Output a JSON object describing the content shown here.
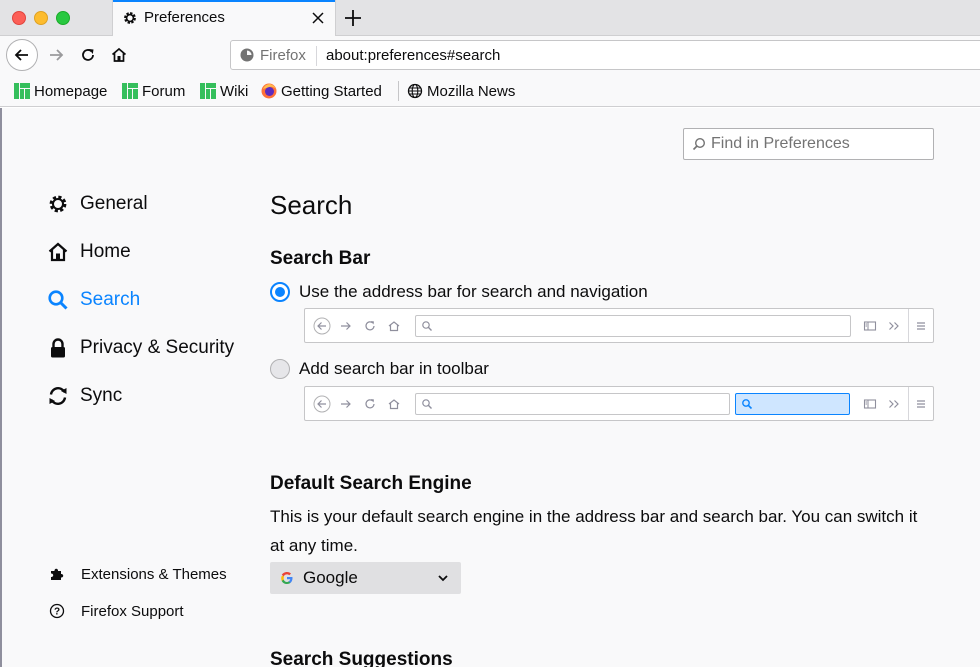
{
  "tab": {
    "title": "Preferences"
  },
  "urlbar": {
    "identity_label": "Firefox",
    "url": "about:preferences#search"
  },
  "bookmarks": [
    "Homepage",
    "Forum",
    "Wiki",
    "Getting Started",
    "Mozilla News"
  ],
  "find": {
    "placeholder": "Find in Preferences"
  },
  "categories": {
    "general": "General",
    "home": "Home",
    "search": "Search",
    "privacy": "Privacy & Security",
    "sync": "Sync"
  },
  "footer": {
    "extensions": "Extensions & Themes",
    "support": "Firefox Support"
  },
  "main": {
    "title": "Search",
    "search_bar_heading": "Search Bar",
    "option_address_bar": "Use the address bar for search and navigation",
    "option_search_bar": "Add search bar in toolbar",
    "selected_option": "option_address_bar",
    "default_engine_heading": "Default Search Engine",
    "default_engine_desc": "This is your default search engine in the address bar and search bar. You can switch it at any time.",
    "default_engine_value": "Google",
    "suggestions_heading": "Search Suggestions"
  },
  "colors": {
    "accent": "#0a84ff",
    "selected_category": "#0a84ff"
  }
}
